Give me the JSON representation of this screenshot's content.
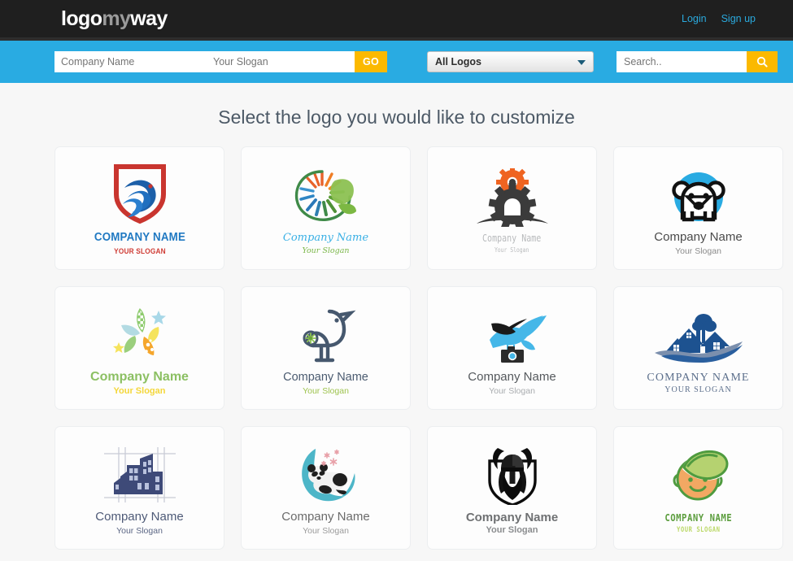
{
  "header": {
    "brand": {
      "part1": "logo",
      "part2": "my",
      "part3": "way"
    },
    "nav": [
      {
        "label": "Login",
        "name": "login-link"
      },
      {
        "label": "Sign up",
        "name": "signup-link"
      }
    ]
  },
  "toolbar": {
    "company_placeholder": "Company Name",
    "company_value": "",
    "slogan_placeholder": "Your Slogan",
    "slogan_value": "",
    "go_label": "GO",
    "category_selected": "All Logos",
    "search_placeholder": "Search..",
    "search_value": "",
    "accent_blue": "#29abe2",
    "accent_amber": "#fbb900"
  },
  "main": {
    "title": "Select the logo you would like to customize"
  },
  "logos": [
    {
      "id": 1,
      "art": "shield-eagle",
      "company": "COMPANY NAME",
      "slogan": "YOUR SLOGAN"
    },
    {
      "id": 2,
      "art": "sunburst-leaf",
      "company": "Company Name",
      "slogan": "Your Slogan"
    },
    {
      "id": 3,
      "art": "gears-sunrise",
      "company": "Company Name",
      "slogan": "Your Slogan"
    },
    {
      "id": 4,
      "art": "dog-circle",
      "company": "Company Name",
      "slogan": "Your Slogan"
    },
    {
      "id": 5,
      "art": "star-flower",
      "company": "Company Name",
      "slogan": "Your Slogan"
    },
    {
      "id": 6,
      "art": "bird-perch",
      "company": "Company Name",
      "slogan": "Your Slogan"
    },
    {
      "id": 7,
      "art": "hummingbird-camera",
      "company": "Company Name",
      "slogan": "Your Slogan"
    },
    {
      "id": 8,
      "art": "houses-wave",
      "company": "COMPANY NAME",
      "slogan": "YOUR SLOGAN"
    },
    {
      "id": 9,
      "art": "city-blueprint",
      "company": "Company Name",
      "slogan": "Your Slogan"
    },
    {
      "id": 10,
      "art": "panda-moon",
      "company": "Company Name",
      "slogan": "Your Slogan"
    },
    {
      "id": 11,
      "art": "viking-shield",
      "company": "Company Name",
      "slogan": "Your Slogan"
    },
    {
      "id": 12,
      "art": "baby-leaf",
      "company": "COMPANY NAME",
      "slogan": "YOUR SLOGAN"
    }
  ]
}
